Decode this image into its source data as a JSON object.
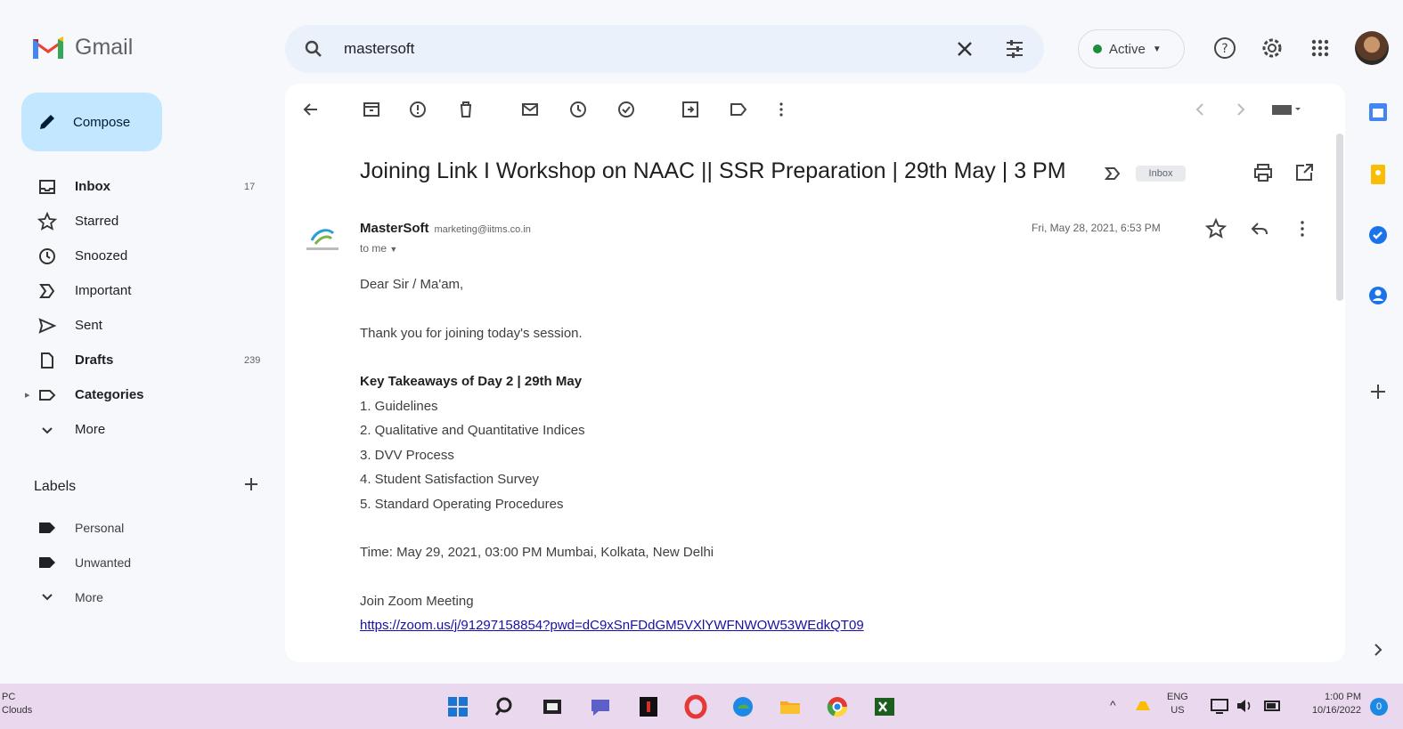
{
  "app": {
    "name": "Gmail"
  },
  "search": {
    "value": "mastersoft"
  },
  "status": {
    "label": "Active"
  },
  "compose": {
    "label": "Compose"
  },
  "nav": [
    {
      "label": "Inbox",
      "count": "17",
      "bold": true,
      "icon": "inbox-icon"
    },
    {
      "label": "Starred",
      "count": "",
      "bold": false,
      "icon": "star-icon"
    },
    {
      "label": "Snoozed",
      "count": "",
      "bold": false,
      "icon": "clock-icon"
    },
    {
      "label": "Important",
      "count": "",
      "bold": false,
      "icon": "important-icon"
    },
    {
      "label": "Sent",
      "count": "",
      "bold": false,
      "icon": "send-icon"
    },
    {
      "label": "Drafts",
      "count": "239",
      "bold": true,
      "icon": "draft-icon"
    },
    {
      "label": "Categories",
      "count": "",
      "bold": true,
      "icon": "label-outline-icon"
    },
    {
      "label": "More",
      "count": "",
      "bold": false,
      "icon": "chevron-down-icon"
    }
  ],
  "labels": {
    "heading": "Labels",
    "items": [
      {
        "label": "Personal",
        "color": "#202124"
      },
      {
        "label": "Unwanted",
        "color": "#202124"
      },
      {
        "label": "More",
        "color": ""
      }
    ]
  },
  "email": {
    "subject": "Joining Link I Workshop on NAAC || SSR Preparation | 29th May | 3 PM",
    "folder_chip": "Inbox",
    "sender_name": "MasterSoft",
    "sender_email": "marketing@iitms.co.in",
    "to": "to me",
    "date": "Fri, May 28, 2021, 6:53 PM",
    "body": {
      "greeting": "Dear Sir / Ma'am,",
      "thanks": "Thank you for joining today's session.",
      "heading": "Key Takeaways of Day 2 | 29th May",
      "points": [
        "1. Guidelines",
        "2. Qualitative and Quantitative Indices",
        "3. DVV Process",
        "4. Student Satisfaction Survey",
        "5. Standard Operating Procedures"
      ],
      "time": "Time: May 29, 2021, 03:00 PM Mumbai, Kolkata, New Delhi",
      "join": "Join Zoom Meeting",
      "link": "https://zoom.us/j/91297158854?pwd=dC9xSnFDdGM5VXlYWFNWOW53WEdkQT09"
    }
  },
  "taskbar": {
    "left_text_1": "PC",
    "left_text_2": "Clouds",
    "lang_1": "ENG",
    "lang_2": "US",
    "time": "1:00 PM",
    "date": "10/16/2022",
    "notifications": "0"
  },
  "colors": {
    "accent": "#c2e7ff",
    "search_bg": "#eaf1fb",
    "app_bg": "#f6f8fc",
    "taskbar": "#ead9ee"
  }
}
